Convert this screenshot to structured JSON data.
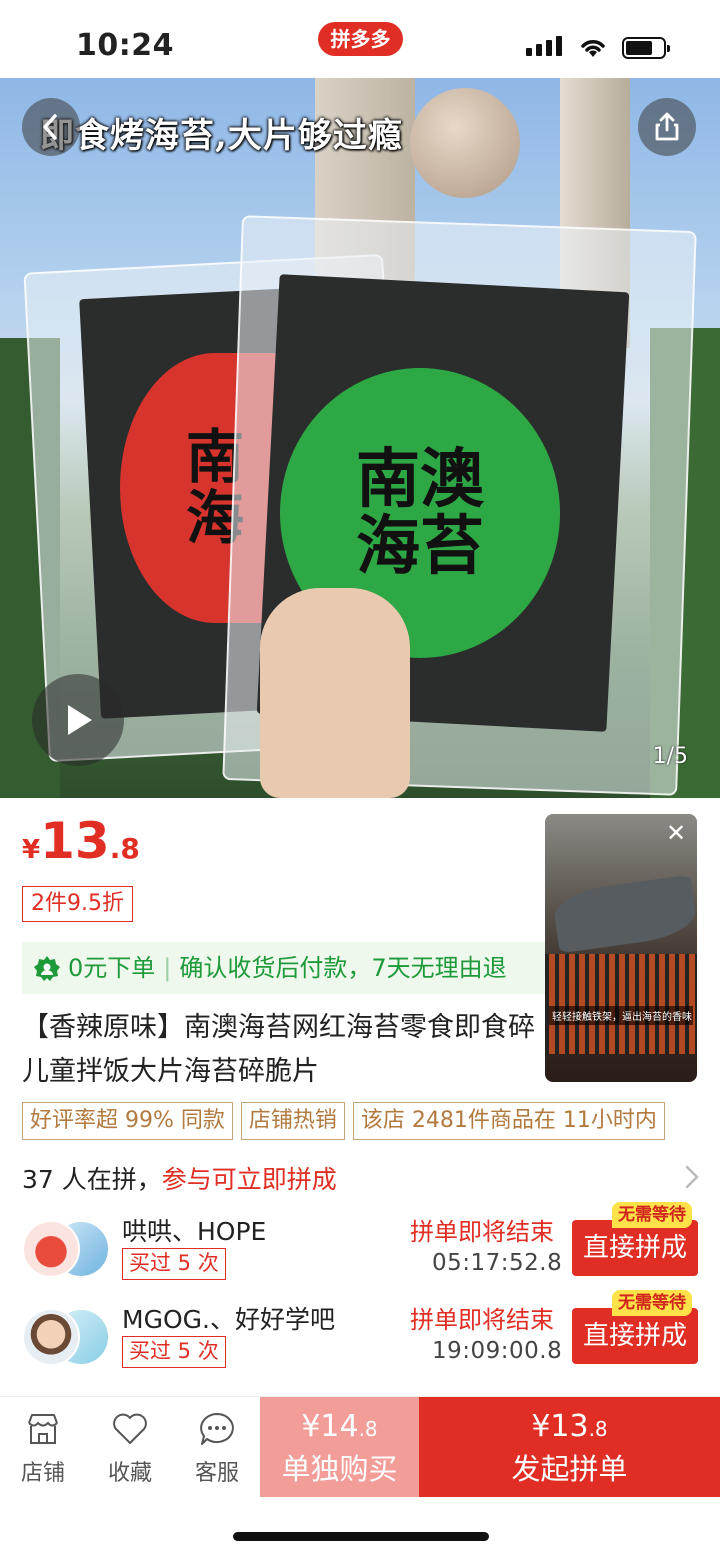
{
  "status_bar": {
    "time": "10:24",
    "app_badge": "拼多多"
  },
  "hero": {
    "title": "即食烤海苔,大片够过瘾",
    "page_indicator": "1/5",
    "label_red": "南\n海",
    "label_green": "南澳\n海苔"
  },
  "price": {
    "currency": "¥",
    "integer": "13",
    "decimal": ".8"
  },
  "discount_tag": "2件9.5折",
  "promise": {
    "part1": "0元下单",
    "part2": "确认收货后付款，7天无理由退"
  },
  "product_title": "【香辣原味】南澳海苔网红海苔零食即食碎儿童拌饭大片海苔碎脆片",
  "video": {
    "caption": "轻轻接触铁架，逼出海苔的香味"
  },
  "tags": [
    "好评率超 99% 同款",
    "店铺热销",
    "该店 2481件商品在 11小时内"
  ],
  "group": {
    "count_text": "37 人在拼，",
    "cta_text": "参与可立即拼成",
    "rows": [
      {
        "names": "哄哄、HOPE",
        "bought": "买过 5 次",
        "ending": "拼单即将结束",
        "countdown": "05:17:52.8",
        "badge": "无需等待",
        "button": "直接拼成"
      },
      {
        "names": "MGOG.、好好学吧",
        "bought": "买过 5 次",
        "ending": "拼单即将结束",
        "countdown": "19:09:00.8",
        "badge": "无需等待",
        "button": "直接拼成"
      }
    ]
  },
  "bottom_bar": {
    "store": "店铺",
    "favorite": "收藏",
    "service": "客服",
    "single_price": "¥14",
    "single_price_dec": ".8",
    "single_label": "单独购买",
    "group_price": "¥13",
    "group_price_dec": ".8",
    "group_label": "发起拼单"
  },
  "colors": {
    "accent": "#e02e24",
    "promise_green": "#1f9a3a",
    "single_buy": "#f29d98",
    "tag_gold": "#b27a3e"
  }
}
